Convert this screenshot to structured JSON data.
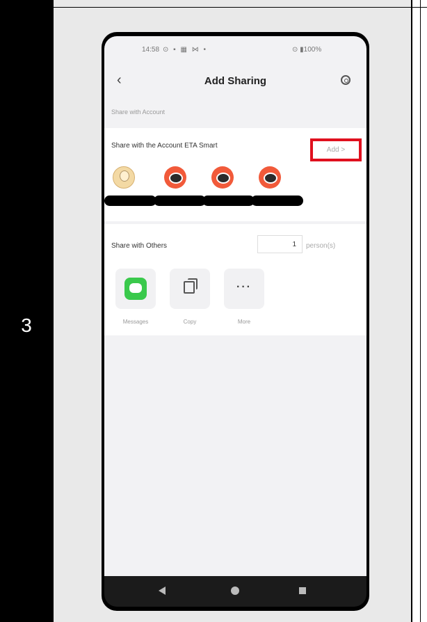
{
  "step_number": "3",
  "status_bar": {
    "time": "14:58",
    "left_icons": "⊙ ▪ ▦ ⋈ •",
    "battery": "⊙ ▮100%"
  },
  "header": {
    "title": "Add Sharing"
  },
  "share_with_account": {
    "section_label": "Share with Account",
    "row_label": "Share with the Account ETA Smart",
    "add_label": "Add >",
    "avatars": [
      "person",
      "robot",
      "robot",
      "robot"
    ]
  },
  "share_with_others": {
    "row_label": "Share with Others",
    "count": "1",
    "unit": "person(s)",
    "options": [
      {
        "label": "Messages",
        "icon": "messages-icon"
      },
      {
        "label": "Copy",
        "icon": "copy-icon"
      },
      {
        "label": "More",
        "icon": "more-icon"
      }
    ]
  },
  "highlight_color": "#e0101e"
}
